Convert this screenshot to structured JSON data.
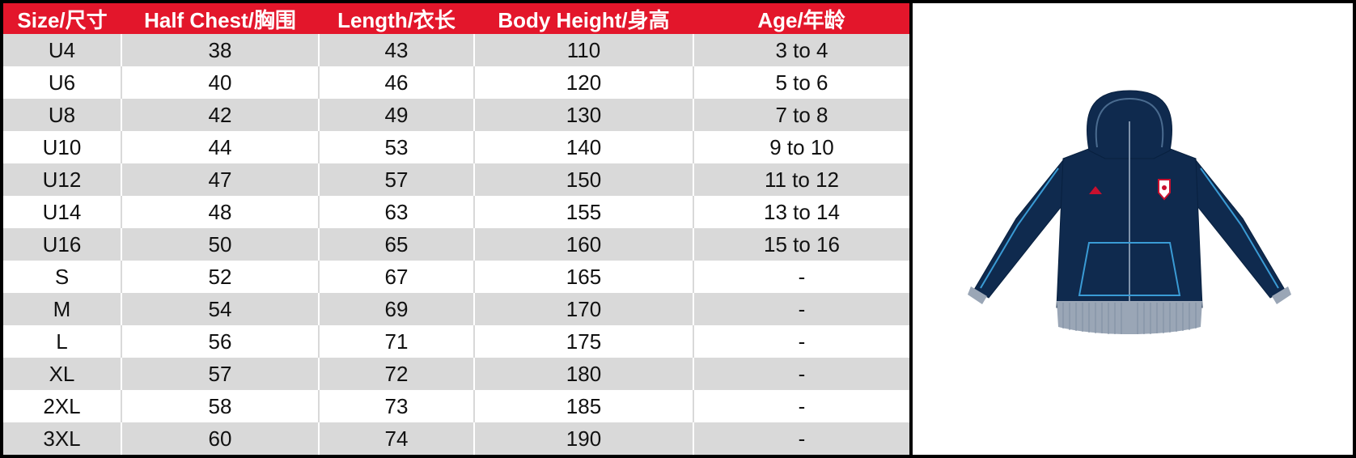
{
  "table": {
    "headers": [
      "Size/尺寸",
      "Half Chest/胸围",
      "Length/衣长",
      "Body Height/身高",
      "Age/年龄"
    ],
    "rows": [
      [
        "U4",
        "38",
        "43",
        "110",
        "3 to 4"
      ],
      [
        "U6",
        "40",
        "46",
        "120",
        "5 to 6"
      ],
      [
        "U8",
        "42",
        "49",
        "130",
        "7 to 8"
      ],
      [
        "U10",
        "44",
        "53",
        "140",
        "9 to 10"
      ],
      [
        "U12",
        "47",
        "57",
        "150",
        "11 to 12"
      ],
      [
        "U14",
        "48",
        "63",
        "155",
        "13 to 14"
      ],
      [
        "U16",
        "50",
        "65",
        "160",
        "15 to 16"
      ],
      [
        "S",
        "52",
        "67",
        "165",
        "-"
      ],
      [
        "M",
        "54",
        "69",
        "170",
        "-"
      ],
      [
        "L",
        "56",
        "71",
        "175",
        "-"
      ],
      [
        "XL",
        "57",
        "72",
        "180",
        "-"
      ],
      [
        "2XL",
        "58",
        "73",
        "185",
        "-"
      ],
      [
        "3XL",
        "60",
        "74",
        "190",
        "-"
      ]
    ]
  },
  "colors": {
    "header_bg": "#e3162b",
    "stripe_bg": "#d9d9d9",
    "hoodie_body": "#0f2a4e",
    "hoodie_trim": "#3a9bd5",
    "cuff": "#9aa6b6"
  },
  "product_image": {
    "icon": "hoodie-icon"
  }
}
